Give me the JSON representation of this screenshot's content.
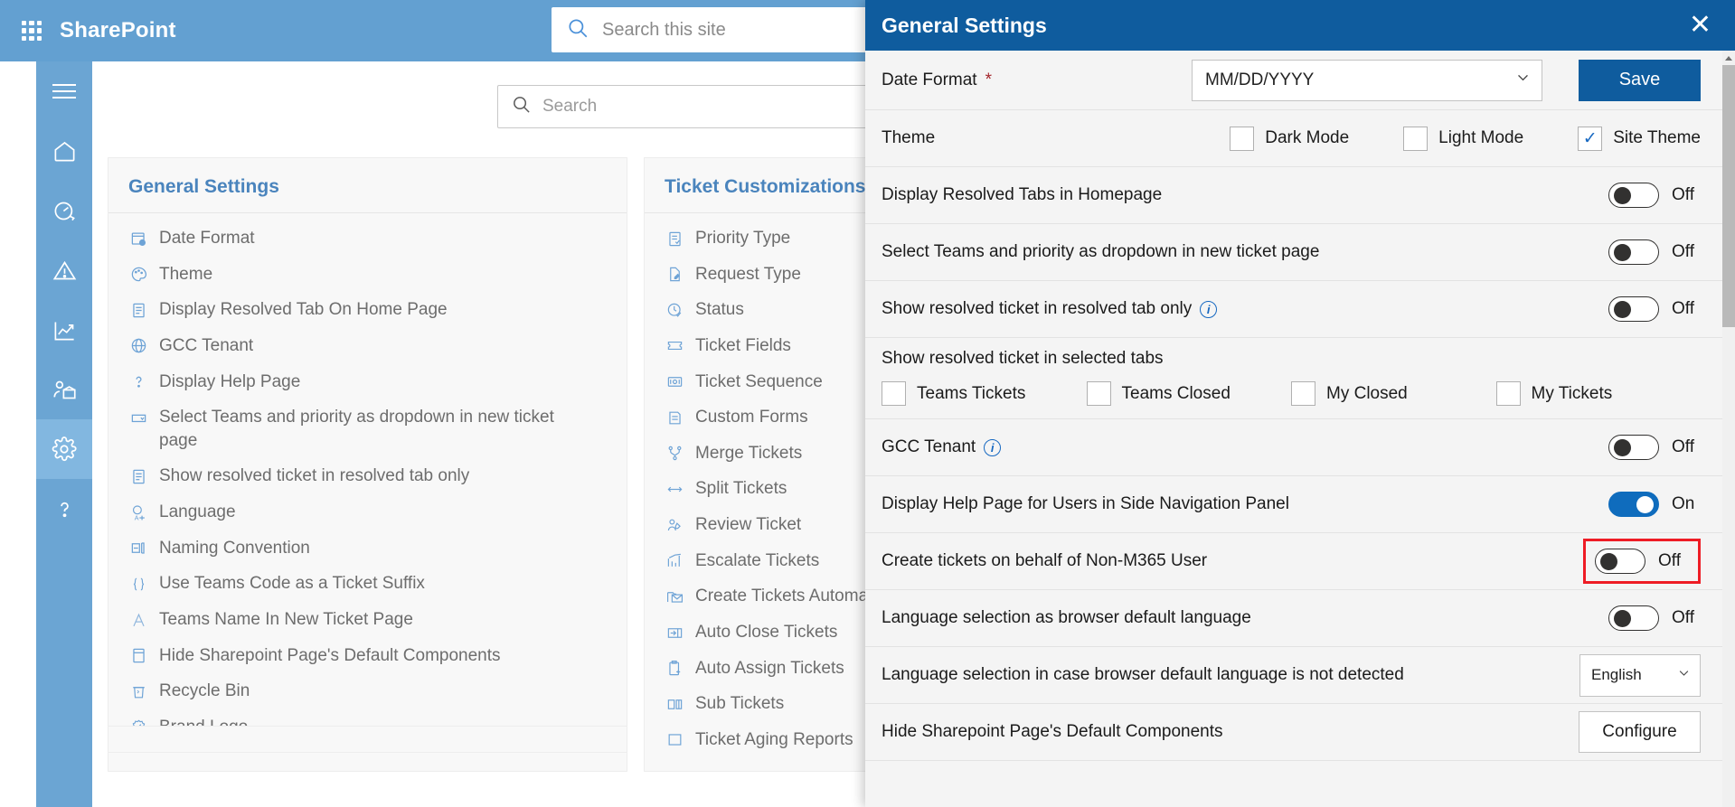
{
  "suitebar": {
    "app_launcher": "waffle-icon",
    "brand": "SharePoint",
    "search_placeholder": "Search this site",
    "search_value": ""
  },
  "rail": {
    "items": [
      {
        "name": "hamburger",
        "label": "Menu"
      },
      {
        "name": "home",
        "label": "Home"
      },
      {
        "name": "dashboard",
        "label": "Dashboard"
      },
      {
        "name": "alerts",
        "label": "Alerts"
      },
      {
        "name": "reports",
        "label": "Reports"
      },
      {
        "name": "teams",
        "label": "Teams"
      },
      {
        "name": "settings",
        "label": "Settings"
      },
      {
        "name": "help",
        "label": "Help"
      }
    ]
  },
  "page": {
    "search_placeholder": "Search",
    "search_value": ""
  },
  "cards": [
    {
      "title": "General Settings",
      "items": [
        {
          "icon": "calendar-clock-icon",
          "label": "Date Format"
        },
        {
          "icon": "palette-icon",
          "label": "Theme"
        },
        {
          "icon": "document-icon",
          "label": "Display Resolved Tab On Home Page"
        },
        {
          "icon": "globe-icon",
          "label": "GCC Tenant"
        },
        {
          "icon": "question-icon",
          "label": "Display Help Page"
        },
        {
          "icon": "dropdown-icon",
          "label": "Select Teams and priority as dropdown in new ticket page"
        },
        {
          "icon": "document-icon",
          "label": "Show resolved ticket in resolved tab only"
        },
        {
          "icon": "translate-icon",
          "label": "Language"
        },
        {
          "icon": "naming-icon",
          "label": "Naming Convention"
        },
        {
          "icon": "braces-icon",
          "label": "Use Teams Code as a Ticket Suffix"
        },
        {
          "icon": "font-icon",
          "label": "Teams Name In New Ticket Page"
        },
        {
          "icon": "page-icon",
          "label": "Hide Sharepoint Page's Default Components"
        },
        {
          "icon": "recycle-bin-icon",
          "label": "Recycle Bin"
        },
        {
          "icon": "badge-icon",
          "label": "Brand Logo"
        }
      ]
    },
    {
      "title": "Ticket Customizations",
      "items": [
        {
          "icon": "checklist-icon",
          "label": "Priority Type"
        },
        {
          "icon": "edit-page-icon",
          "label": "Request Type"
        },
        {
          "icon": "clock-check-icon",
          "label": "Status"
        },
        {
          "icon": "ticket-icon",
          "label": "Ticket Fields"
        },
        {
          "icon": "sequence-icon",
          "label": "Ticket Sequence"
        },
        {
          "icon": "form-icon",
          "label": "Custom Forms"
        },
        {
          "icon": "merge-icon",
          "label": "Merge Tickets"
        },
        {
          "icon": "split-icon",
          "label": "Split Tickets"
        },
        {
          "icon": "review-icon",
          "label": "Review Ticket"
        },
        {
          "icon": "escalate-chart-icon",
          "label": "Escalate Tickets"
        },
        {
          "icon": "mail-folder-icon",
          "label": "Create Tickets Automatically"
        },
        {
          "icon": "auto-close-icon",
          "label": "Auto Close Tickets"
        },
        {
          "icon": "clipboard-arrow-icon",
          "label": "Auto Assign Tickets"
        },
        {
          "icon": "sub-tickets-icon",
          "label": "Sub Tickets"
        },
        {
          "icon": "square-icon",
          "label": "Ticket Aging Reports"
        }
      ]
    }
  ],
  "panel": {
    "title": "General Settings",
    "close_icon": "close-icon",
    "save_label": "Save",
    "rows": {
      "date_format": {
        "label": "Date Format",
        "required_mark": "*",
        "value": "MM/DD/YYYY"
      },
      "theme": {
        "label": "Theme",
        "options": [
          {
            "label": "Dark Mode",
            "checked": false
          },
          {
            "label": "Light Mode",
            "checked": false
          },
          {
            "label": "Site Theme",
            "checked": true
          }
        ]
      },
      "display_resolved_tabs": {
        "label": "Display Resolved Tabs in Homepage",
        "state": "Off",
        "on": false
      },
      "select_teams_priority": {
        "label": "Select Teams and priority as dropdown in new ticket page",
        "state": "Off",
        "on": false
      },
      "show_resolved_only": {
        "label": "Show resolved ticket in resolved tab only",
        "info": "info-icon",
        "state": "Off",
        "on": false
      },
      "selected_tabs": {
        "label": "Show resolved ticket in selected tabs",
        "options": [
          {
            "label": "Teams Tickets",
            "checked": false
          },
          {
            "label": "Teams Closed",
            "checked": false
          },
          {
            "label": "My Closed",
            "checked": false
          },
          {
            "label": "My Tickets",
            "checked": false
          }
        ]
      },
      "gcc_tenant": {
        "label": "GCC Tenant",
        "info": "info-icon",
        "state": "Off",
        "on": false
      },
      "display_help_page": {
        "label": "Display Help Page for Users in Side Navigation Panel",
        "state": "On",
        "on": true
      },
      "create_behalf": {
        "label": "Create tickets on behalf of Non-M365 User",
        "state": "Off",
        "on": false,
        "highlighted": true
      },
      "language_browser_default": {
        "label": "Language selection as browser default language",
        "state": "Off",
        "on": false
      },
      "language_fallback": {
        "label": "Language selection in case browser default language is not detected",
        "value": "English"
      },
      "hide_default_components": {
        "label": "Hide Sharepoint Page's Default Components",
        "button": "Configure"
      }
    }
  },
  "colors": {
    "suitebar": "#63a0d1",
    "rail": "#6ba5d3",
    "panel_header": "#0f5c9e",
    "accent": "#0f6cbd",
    "card_title": "#4a84bd",
    "highlight": "#ee1c25",
    "required": "#a4262c"
  }
}
